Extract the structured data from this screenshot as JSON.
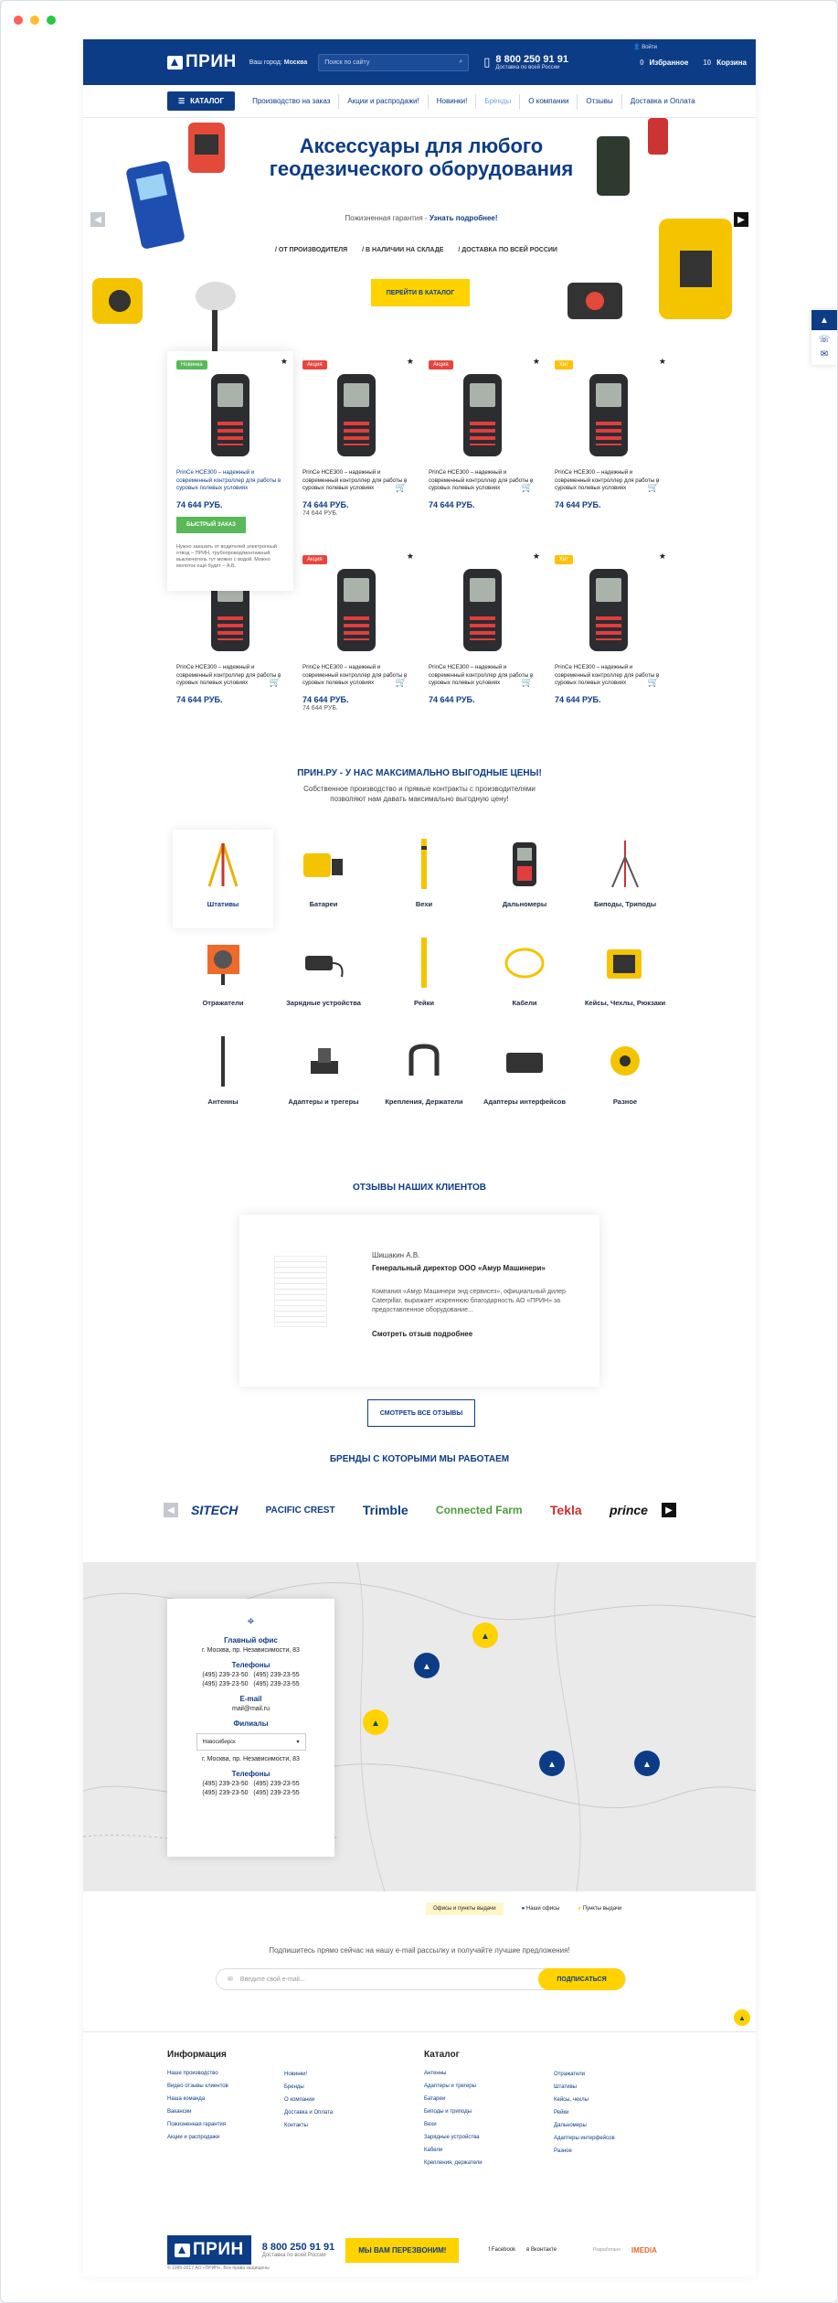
{
  "header": {
    "logo": "ПРИН",
    "city_label": "Ваш город:",
    "city": "Москва",
    "search_placeholder": "Поиск по сайту",
    "phone": "8 800 250 91 91",
    "phone_sub": "Доставка по всей России",
    "favorites": "Избранное",
    "fav_count": "0",
    "cart": "Корзина",
    "cart_count": "10",
    "login": "Войти"
  },
  "nav": {
    "catalog": "КАТАЛОГ",
    "items": [
      "Производство на заказ",
      "Акции и распродажи!",
      "Новинки!",
      "Бренды",
      "О компании",
      "Отзывы",
      "Доставка и Оплата"
    ]
  },
  "hero": {
    "title": "Аксессуары для любого геодезического оборудования",
    "guarantee": "Пожизненная гарантия - ",
    "guarantee_link": "Узнать подробнее!",
    "features": [
      "/ ОТ ПРОИЗВОДИТЕЛЯ",
      "/ В НАЛИЧИИ НА СКЛАДЕ",
      "/ ДОСТАВКА ПО ВСЕЙ РОССИИ"
    ],
    "button": "ПЕРЕЙТИ В КАТАЛОГ"
  },
  "products": {
    "row1": [
      {
        "badge": "Новинка",
        "badge_color": "#59b857",
        "star": "★",
        "desc": "PrinCe HCE300 – надежный и современный контроллер для работы в суровых полевых условиях",
        "price": "74 644 РУБ.",
        "old": "",
        "quick": "БЫСТРЫЙ ЗАКАЗ",
        "review": "Нужно заказать от водителей электронный отвод – ПРИН, трубопровод/монтажный выключатель тут можно с водой. Можно молоток ещё будет – А.Б."
      },
      {
        "badge": "Акция",
        "badge_color": "#e7453e",
        "star": "★",
        "desc": "PrinCe HCE300 – надежный и современный контроллер для работы в суровых полевых условиях",
        "price": "74 644 РУБ.",
        "old": "74 644 РУБ."
      },
      {
        "badge": "Акция",
        "badge_color": "#e7453e",
        "star": "★",
        "desc": "PrinCe HCE300 – надежный и современный контроллер для работы в суровых полевых условиях",
        "price": "74 644 РУБ.",
        "old": ""
      },
      {
        "badge": "Хит",
        "badge_color": "#ffc107",
        "star": "★",
        "desc": "PrinCe HCE300 – надежный и современный контроллер для работы в суровых полевых условиях",
        "price": "74 644 РУБ.",
        "old": ""
      }
    ],
    "row2": [
      {
        "badge": "",
        "badge_color": "",
        "star": "",
        "desc": "PrinCe HCE300 – надежный и современный контроллер для работы в суровых полевых условиях",
        "price": "74 644 РУБ.",
        "old": ""
      },
      {
        "badge": "Акция",
        "badge_color": "#e7453e",
        "star": "★",
        "desc": "PrinCe HCE300 – надежный и современный контроллер для работы в суровых полевых условиях",
        "price": "74 644 РУБ.",
        "old": "74 644 РУБ."
      },
      {
        "badge": "",
        "badge_color": "",
        "star": "★",
        "desc": "PrinCe HCE300 – надежный и современный контроллер для работы в суровых полевых условиях",
        "price": "74 644 РУБ.",
        "old": ""
      },
      {
        "badge": "Хит",
        "badge_color": "#ffc107",
        "star": "★",
        "desc": "PrinCe HCE300 – надежный и современный контроллер для работы в суровых полевых условиях",
        "price": "74 644 РУБ.",
        "old": ""
      }
    ]
  },
  "promo": {
    "title": "ПРИН.РУ - У НАС МАКСИМАЛЬНО ВЫГОДНЫЕ ЦЕНЫ!",
    "sub1": "Собственное производство и прямые контракты с производителями",
    "sub2": "позволяют нам давать максимально выгодную цену!"
  },
  "categories": [
    "Штативы",
    "Батареи",
    "Вехи",
    "Дальномеры",
    "Биподы, Триподы",
    "Отражатели",
    "Зарядные устройства",
    "Рейки",
    "Кабели",
    "Кейсы, Чехлы, Рюкзаки",
    "Антенны",
    "Адаптеры и трегеры",
    "Крепления, Держатели",
    "Адаптеры интерфейсов",
    "Разное"
  ],
  "reviews": {
    "title": "ОТЗЫВЫ НАШИХ КЛИЕНТОВ",
    "name": "Шишакин А.В.",
    "role": "Генеральный директор ООО «Амур Машинери»",
    "text": "Компания «Амур Машинери энд сервисез», официальный дилер Caterpillar, выражает искреннюю благодарность АО «ПРИН» за предоставленное оборудование...",
    "more": "Смотреть отзыв подробнее",
    "all": "СМОТРЕТЬ ВСЕ ОТЗЫВЫ"
  },
  "brands": {
    "title": "БРЕНДЫ С КОТОРЫМИ МЫ РАБОТАЕМ",
    "items": [
      "SITECH",
      "PACIFIC CREST",
      "Trimble",
      "Connected Farm",
      "Tekla",
      "prince"
    ]
  },
  "office": {
    "main": "Главный офис",
    "address": "г. Москва, пр. Независимости, 83",
    "phones_title": "Телефоны",
    "phones": [
      "(495) 239-23-50",
      "(495) 239-23-55",
      "(495) 239-23-50",
      "(495) 239-23-55"
    ],
    "email_title": "E-mail",
    "email": "mail@mail.ru",
    "branches": "Филиалы",
    "branch_city": "Новосибирск",
    "branch_address": "г. Москва, пр. Независимости, 83",
    "branch_phones": [
      "(495) 239-23-50",
      "(495) 239-23-55",
      "(495) 239-23-50",
      "(495) 239-23-55"
    ]
  },
  "legend": [
    "Офисы и пункты выдачи",
    "Наши офисы",
    "Пункты выдачи"
  ],
  "subscribe": {
    "text": "Подпишитесь прямо сейчас на нашу e-mail рассылку и получайте лучшие предложения!",
    "placeholder": "Введите свой e-mail...",
    "button": "ПОДПИСАТЬСЯ"
  },
  "footer": {
    "info_title": "Информация",
    "info_col1": [
      "Наше производство",
      "Видео отзывы клиентов",
      "Наша команда",
      "Вакансии",
      "Пожизненная гарантия",
      "Акции и распродажи"
    ],
    "info_col2": [
      "Новинки!",
      "Бренды",
      "О компании",
      "Доставка и Оплата",
      "Контакты"
    ],
    "cat_title": "Каталог",
    "cat_col1": [
      "Антенны",
      "Адаптеры и трегеры",
      "Батареи",
      "Биподы и триподы",
      "Вехи",
      "Зарядные устройства",
      "Кабели",
      "Крепления, держатели"
    ],
    "cat_col2": [
      "Отражатели",
      "Штативы",
      "Кейсы, чехлы",
      "Рейки",
      "Дальномеры",
      "Адаптеры интерфейсов",
      "Разное"
    ],
    "logo": "ПРИН",
    "phone": "8 800 250 91 91",
    "phone_sub": "Доставка по всей России",
    "callback": "МЫ ВАМ ПЕРЕЗВОНИМ!",
    "social": [
      "Facebook",
      "Вконтакте"
    ],
    "dev_label": "Разработано",
    "dev": "IMEDIA",
    "copyright": "© 1995-2017 АО «ПРИН». Все права защищены"
  },
  "colors": {
    "brand": "#0c3c86",
    "accent": "#ffd200",
    "sale": "#e7453e",
    "new": "#59b857"
  }
}
